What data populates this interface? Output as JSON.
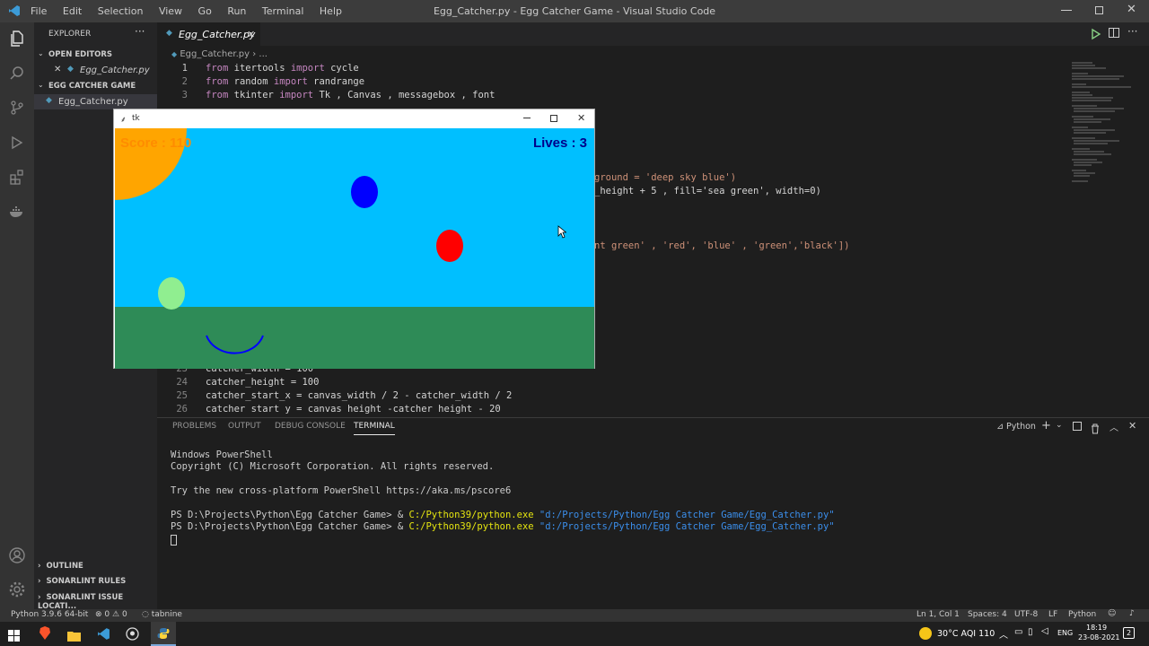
{
  "titlebar": {
    "menu": [
      "File",
      "Edit",
      "Selection",
      "View",
      "Go",
      "Run",
      "Terminal",
      "Help"
    ],
    "title": "Egg_Catcher.py - Egg Catcher Game - Visual Studio Code"
  },
  "sidebar": {
    "header": "EXPLORER",
    "open_editors": "OPEN EDITORS",
    "open_file": "Egg_Catcher.py",
    "folder": "EGG CATCHER GAME",
    "folder_file": "Egg_Catcher.py",
    "outline": "OUTLINE",
    "sonar_rules": "SONARLINT RULES",
    "sonar_issues": "SONARLINT ISSUE LOCATI..."
  },
  "editor": {
    "tab": "Egg_Catcher.py",
    "breadcrumb": "Egg_Catcher.py",
    "breadcrumb_more": "...",
    "lines_top": [
      {
        "n": "1",
        "a": "from",
        "b": " itertools ",
        "c": "import",
        "d": " cycle"
      },
      {
        "n": "2",
        "a": "from",
        "b": " random ",
        "c": "import",
        "d": " randrange"
      },
      {
        "n": "3",
        "a": "from",
        "b": " tkinter ",
        "c": "import",
        "d": " Tk , Canvas , messagebox , font"
      }
    ],
    "partial_1": "ground = 'deep sky blue')",
    "partial_2": "_height + 5 , fill='sea green', width=0)",
    "partial_3": "nt green' , 'red', 'blue' , 'green','black'])",
    "lines_bottom": [
      {
        "n": "23",
        "t": "catcher_width = 100"
      },
      {
        "n": "24",
        "t": "catcher_height = 100"
      },
      {
        "n": "25",
        "t": "catcher_start_x = canvas_width / 2 - catcher_width / 2"
      },
      {
        "n": "26",
        "t": "catcher_start_y = canvas_height -catcher_height - 20"
      }
    ]
  },
  "panel": {
    "tabs": [
      "PROBLEMS",
      "OUTPUT",
      "DEBUG CONSOLE",
      "TERMINAL"
    ],
    "shell": "Python",
    "terminal": [
      "Windows PowerShell",
      "Copyright (C) Microsoft Corporation. All rights reserved.",
      "",
      "Try the new cross-platform PowerShell https://aka.ms/pscore6",
      ""
    ],
    "prompt": "PS D:\\Projects\\Python\\Egg Catcher Game> & ",
    "exe": "C:/Python39/python.exe",
    "arg": " \"d:/Projects/Python/Egg Catcher Game/Egg_Catcher.py\""
  },
  "status": {
    "python": "Python 3.9.6 64-bit",
    "errors": "0",
    "warnings": "0",
    "tabnine": "tabnine",
    "position": "Ln 1, Col 1",
    "spaces": "Spaces: 4",
    "encoding": "UTF-8",
    "eol": "LF",
    "lang": "Python"
  },
  "taskbar": {
    "weather": "30°C  AQI 110",
    "lang": "ENG",
    "time": "18:19",
    "date": "23-08-2021",
    "notif": "2"
  },
  "tk": {
    "title": "tk",
    "score": "Score : 110",
    "lives": "Lives : 3"
  },
  "colors": {
    "sky": "#00bfff",
    "ground": "#2e8b57",
    "sun": "#ffa500",
    "egg_blue": "#0000ff",
    "egg_red": "#ff0000",
    "egg_green": "#90ee90",
    "catcher": "#0000ff",
    "score_text": "#ff8c00",
    "lives_text": "#00008b"
  }
}
